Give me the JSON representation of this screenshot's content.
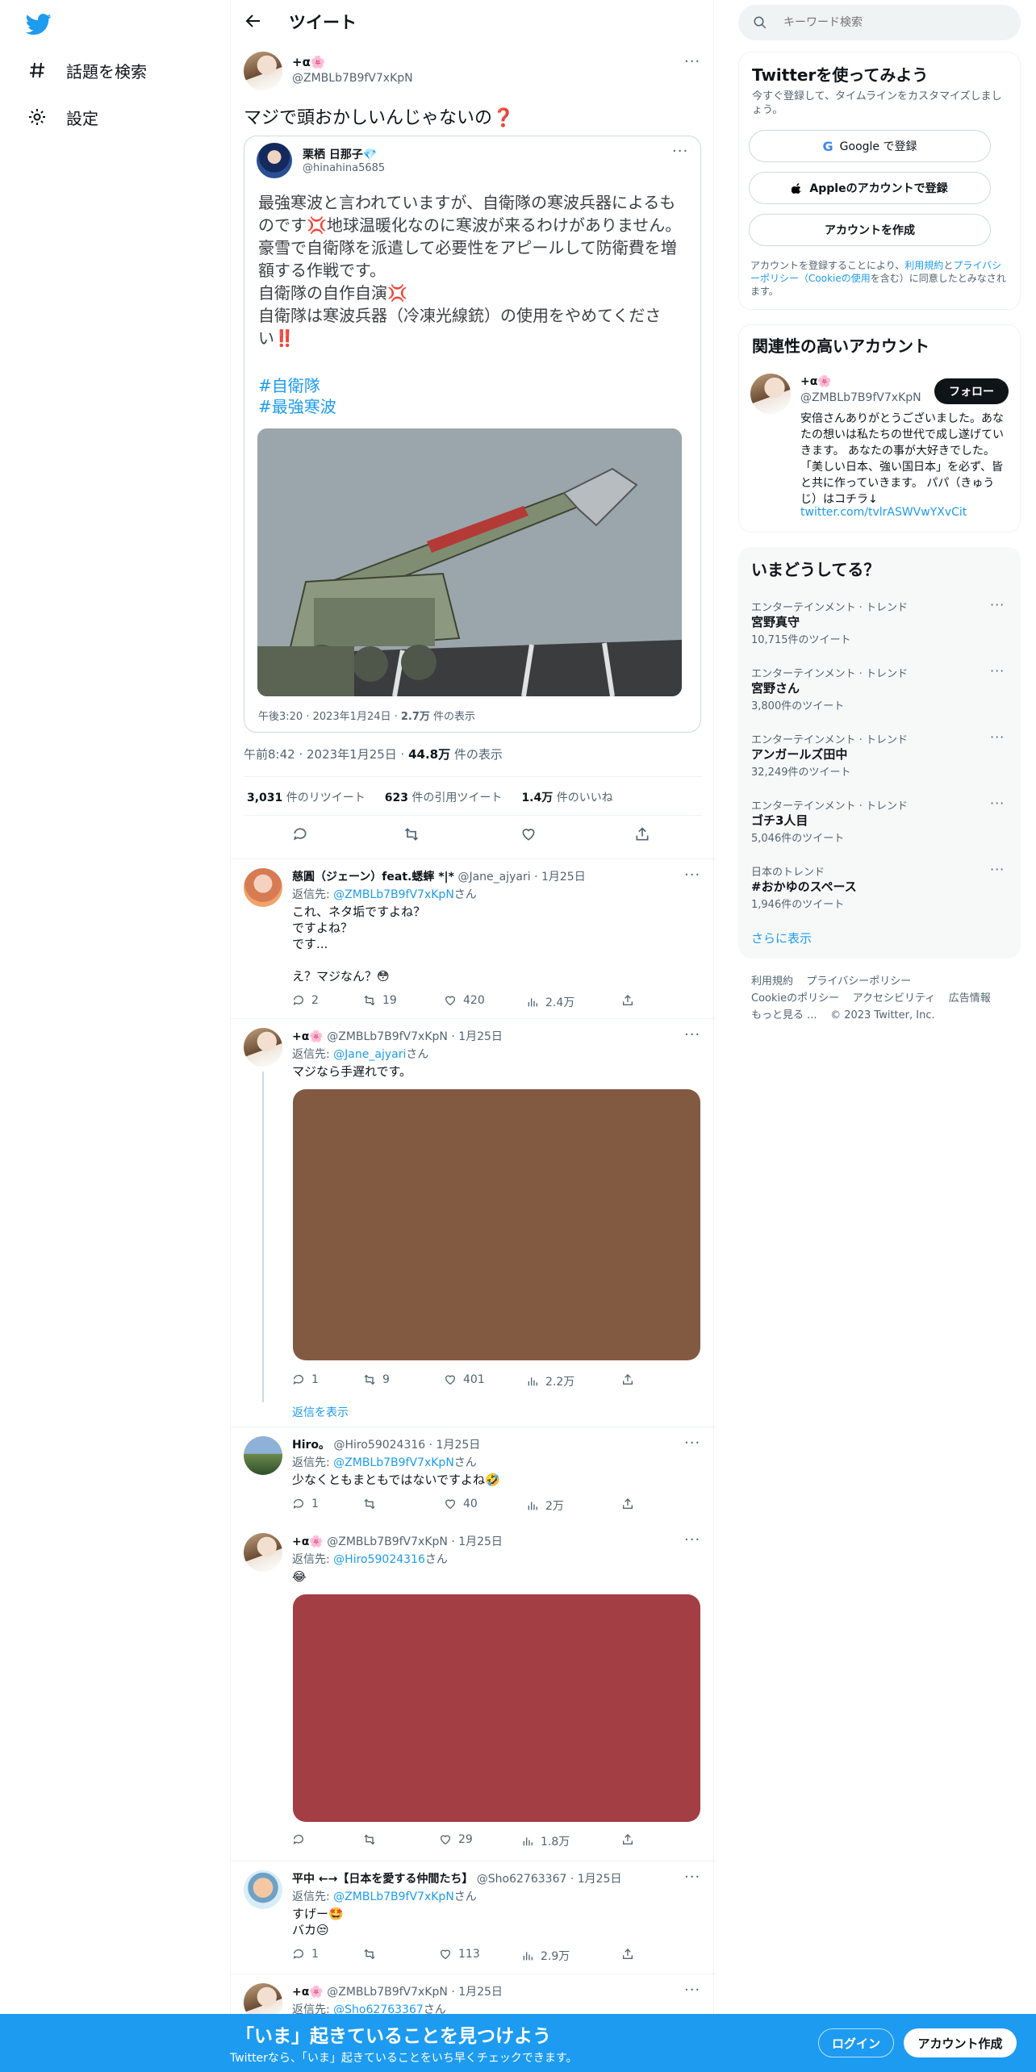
{
  "nav": {
    "explore_label": "話題を検索",
    "settings_label": "設定"
  },
  "header": {
    "title": "ツイート"
  },
  "main_tweet": {
    "display_name": "+α🌸",
    "handle": "@ZMBLb7B9fV7xKpN",
    "text": "マジで頭おかしいんじゃないの❓",
    "quote": {
      "display_name": "栗栖 日那子💎",
      "handle": "@hinahina5685",
      "text": "最強寒波と言われていますが、自衛隊の寒波兵器によるものです💢地球温暖化なのに寒波が来るわけがありません。\n豪雪で自衛隊を派遣して必要性をアピールして防衛費を増額する作戦です。\n自衛隊の自作自演💢\n自衛隊は寒波兵器（冷凍光線銃）の使用をやめてください‼️",
      "hashtags": [
        "#自衛隊",
        "#最強寒波"
      ],
      "meta": "午後3:20 · 2023年1月24日 · ",
      "views_value": "2.7万",
      "views_label": " 件の表示"
    },
    "meta": "午前8:42 · 2023年1月25日 · ",
    "views_value": "44.8万",
    "views_label": " 件の表示",
    "stats": {
      "retweets_value": "3,031",
      "retweets_label": " 件のリツイート",
      "quotes_value": "623",
      "quotes_label": " 件の引用ツイート",
      "likes_value": "1.4万",
      "likes_label": " 件のいいね"
    }
  },
  "replies": [
    {
      "display_name": "慈圓（ジェーン）feat.蟋蟀 *|*",
      "handle": "@Jane_ajyari",
      "date": "· 1月25日",
      "reply_prefix": "返信先: ",
      "reply_to": "@ZMBLb7B9fV7xKpN",
      "reply_suffix": "さん",
      "text": "これ、ネタ垢ですよね？\nですよね？\nです...\n\nえ？マジなん？😳",
      "counts": {
        "reply": "2",
        "retweet": "19",
        "like": "420",
        "views": "2.4万"
      }
    },
    {
      "display_name": "+α🌸",
      "handle": "@ZMBLb7B9fV7xKpN",
      "date": "· 1月25日",
      "reply_prefix": "返信先: ",
      "reply_to": "@Jane_ajyari",
      "reply_suffix": "さん",
      "text": "マジなら手遅れです。",
      "image_color": "#825a42",
      "counts": {
        "reply": "1",
        "retweet": "9",
        "like": "401",
        "views": "2.2万"
      },
      "show_replies": "返信を表示"
    },
    {
      "display_name": "Hiro。",
      "handle": "@Hiro59024316",
      "date": "· 1月25日",
      "reply_prefix": "返信先: ",
      "reply_to": "@ZMBLb7B9fV7xKpN",
      "reply_suffix": "さん",
      "text": "少なくともまともではないですよね🤣",
      "counts": {
        "reply": "1",
        "retweet": "",
        "like": "40",
        "views": "2万"
      }
    },
    {
      "display_name": "+α🌸",
      "handle": "@ZMBLb7B9fV7xKpN",
      "date": "· 1月25日",
      "reply_prefix": "返信先: ",
      "reply_to": "@Hiro59024316",
      "reply_suffix": "さん",
      "text": "😂",
      "image_color": "#a23e44",
      "counts": {
        "reply": "",
        "retweet": "",
        "like": "29",
        "views": "1.8万"
      }
    },
    {
      "display_name": "平中 ←→【日本を愛する仲間たち】",
      "handle": "@Sho62763367",
      "date": "· 1月25日",
      "reply_prefix": "返信先: ",
      "reply_to": "@ZMBLb7B9fV7xKpN",
      "reply_suffix": "さん",
      "text": "すげー🤩\nバカ😒",
      "counts": {
        "reply": "1",
        "retweet": "",
        "like": "113",
        "views": "2.9万"
      }
    },
    {
      "display_name": "+α🌸",
      "handle": "@ZMBLb7B9fV7xKpN",
      "date": "· 1月25日",
      "reply_prefix": "返信先: ",
      "reply_to": "@Sho62763367",
      "reply_suffix": "さん"
    }
  ],
  "sidebar": {
    "search_placeholder": "キーワード検索",
    "signup": {
      "title": "Twitterを使ってみよう",
      "subtitle": "今すぐ登録して、タイムラインをカスタマイズしましょう。",
      "google_label": "Google で登録",
      "apple_label": "Appleのアカウントで登録",
      "create_label": "アカウントを作成",
      "legal_1": "アカウントを登録することにより、",
      "legal_terms": "利用規約",
      "legal_2": "と",
      "legal_privacy": "プライバシーポリシー（Cookieの使用",
      "legal_3": "を含む）に同意したとみなされます。"
    },
    "relevant": {
      "title": "関連性の高いアカウント",
      "display_name": "+α🌸",
      "handle": "@ZMBLb7B9fV7xKpN",
      "follow_label": "フォロー",
      "bio": "安倍さんありがとうございました。あなたの想いは私たちの世代で成し遂げていきます。 あなたの事が大好きでした。「美しい日本、強い国日本」を必ず、皆と共に作っていきます。 パパ（きゅうじ）はコチラ↓",
      "bio_link": "twitter.com/tvlrASWVwYXvCit"
    },
    "trends": {
      "title": "いまどうしてる？",
      "items": [
        {
          "category": "エンターテインメント · トレンド",
          "name": "宮野真守",
          "count": "10,715件のツイート"
        },
        {
          "category": "エンターテインメント · トレンド",
          "name": "宮野さん",
          "count": "3,800件のツイート"
        },
        {
          "category": "エンターテインメント · トレンド",
          "name": "アンガールズ田中",
          "count": "32,249件のツイート"
        },
        {
          "category": "エンターテインメント · トレンド",
          "name": "ゴチ3人目",
          "count": "5,046件のツイート"
        },
        {
          "category": "日本のトレンド",
          "name": "#おかゆのスペース",
          "count": "1,946件のツイート"
        }
      ],
      "show_more": "さらに表示"
    },
    "footer": {
      "terms": "利用規約",
      "privacy": "プライバシーポリシー",
      "cookie": "Cookieのポリシー",
      "accessibility": "アクセシビリティ",
      "ads": "広告情報",
      "more": "もっと見る ...",
      "copyright": "© 2023 Twitter, Inc."
    }
  },
  "banner": {
    "title": "「いま」起きていることを見つけよう",
    "subtitle": "Twitterなら、「いま」起きていることをいち早くチェックできます。",
    "login_label": "ログイン",
    "signup_label": "アカウント作成"
  },
  "colors": {
    "accent": "#1d9bf0",
    "text": "#0f1419",
    "muted": "#536471",
    "border": "#eff3f4"
  }
}
